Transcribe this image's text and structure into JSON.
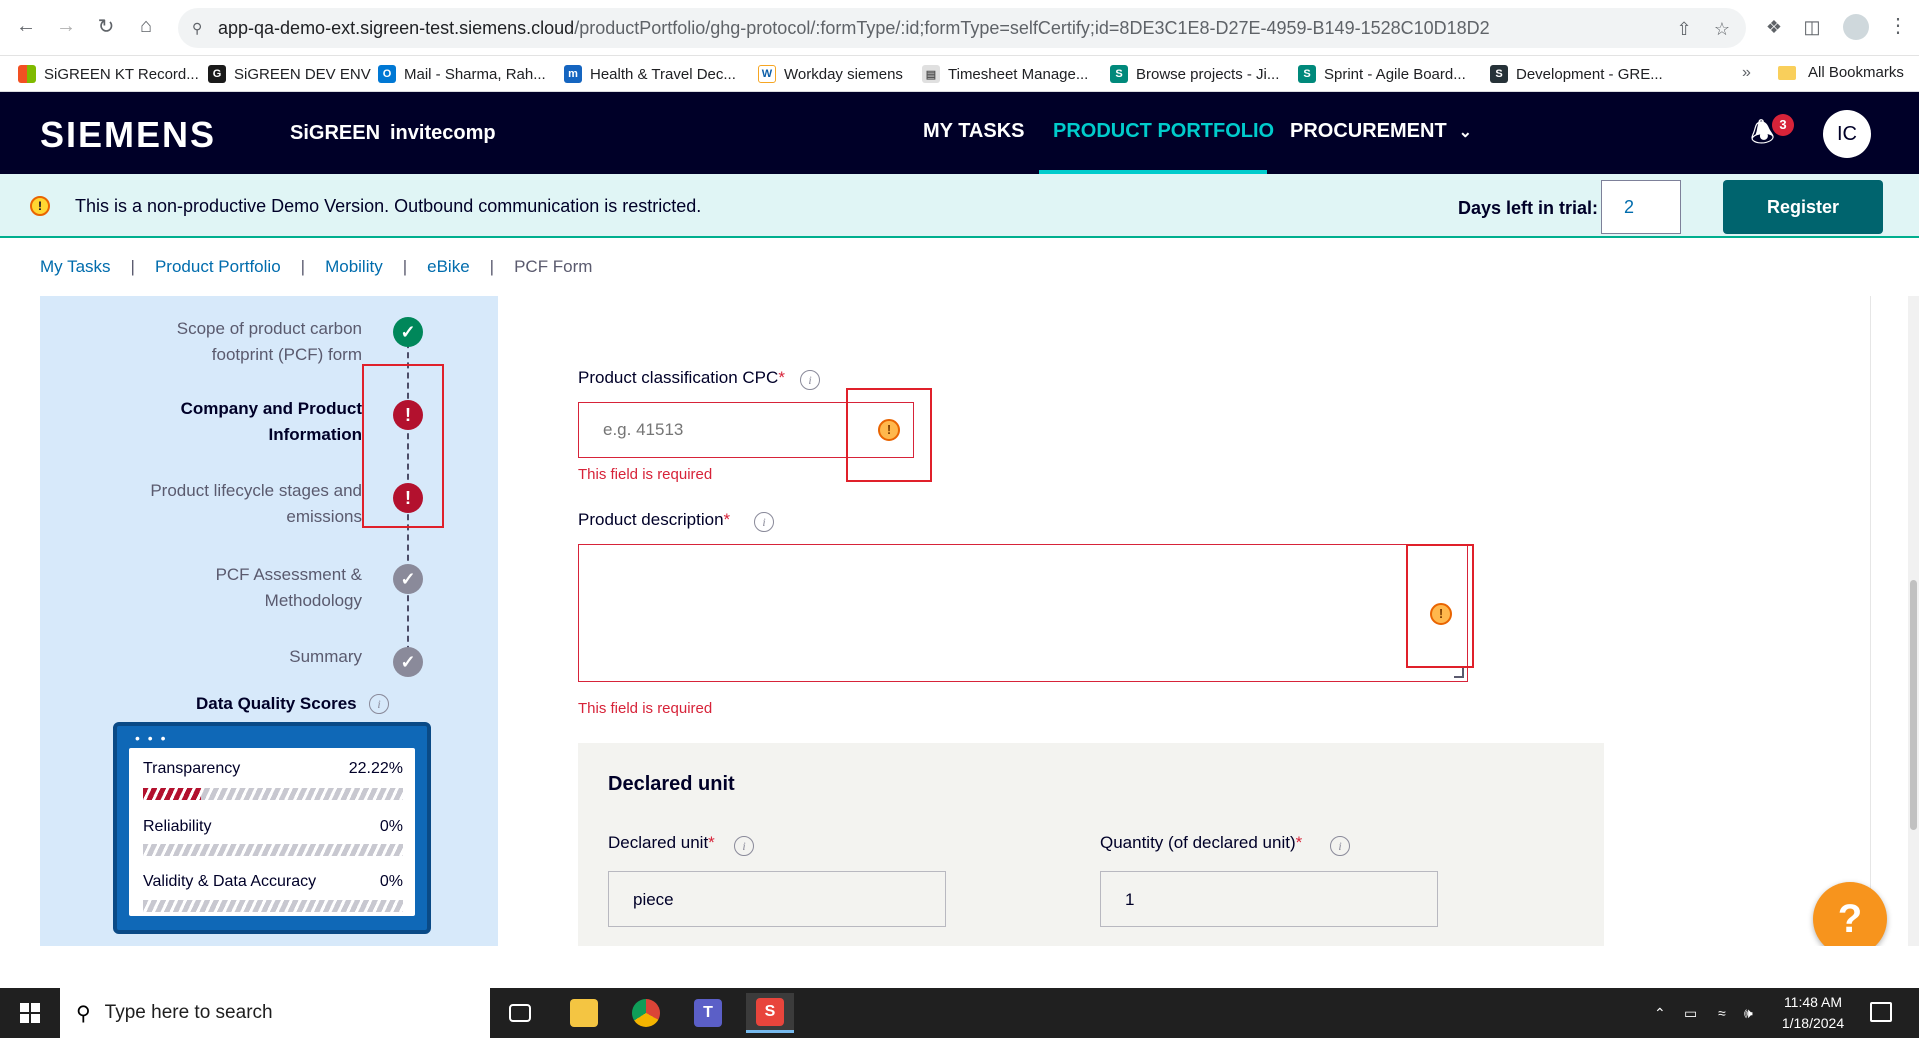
{
  "browser": {
    "url_host": "app-qa-demo-ext.sigreen-test.siemens.cloud",
    "url_path": "/productPortfolio/ghg-protocol/:formType/:id;formType=selfCertify;id=8DE3C1E8-D27E-4959-B149-1528C10D18D2",
    "bookmarks": [
      {
        "label": "SiGREEN KT Record...",
        "icon": "ms-grid-icon",
        "color": "#f25022"
      },
      {
        "label": "SiGREEN DEV ENV",
        "icon": "gw-icon",
        "color": "#1a1a1a"
      },
      {
        "label": "Mail - Sharma, Rah...",
        "icon": "outlook-icon",
        "color": "#0078d4"
      },
      {
        "label": "Health & Travel Dec...",
        "icon": "mx-icon",
        "color": "#1565c0"
      },
      {
        "label": "Workday siemens",
        "icon": "workday-icon",
        "color": "#f6a623"
      },
      {
        "label": "Timesheet Manage...",
        "icon": "doc-icon",
        "color": "#9e9e9e"
      },
      {
        "label": "Browse projects - Ji...",
        "icon": "s-icon",
        "color": "#00897b"
      },
      {
        "label": "Sprint - Agile Board...",
        "icon": "s-icon",
        "color": "#00897b"
      },
      {
        "label": "Development - GRE...",
        "icon": "s-icon",
        "color": "#263238"
      }
    ],
    "more": "»",
    "all_bookmarks": "All Bookmarks"
  },
  "header": {
    "brand": "SIEMENS",
    "app_name": "SiGREEN",
    "company": "invitecomp",
    "nav": [
      {
        "label": "MY TASKS",
        "active": false
      },
      {
        "label": "PRODUCT PORTFOLIO",
        "active": true
      },
      {
        "label": "PROCUREMENT",
        "active": false
      }
    ],
    "notification_count": "3",
    "user_initials": "IC"
  },
  "banner": {
    "message": "This is a non-productive Demo Version. Outbound communication is restricted.",
    "trial_label": "Days left in trial:",
    "trial_days": "2",
    "register_label": "Register"
  },
  "breadcrumb": [
    "My Tasks",
    "Product Portfolio",
    "Mobility",
    "eBike",
    "PCF Form"
  ],
  "stepper": {
    "steps": [
      {
        "line1": "Scope of product carbon",
        "line2": "footprint (PCF) form",
        "status": "complete"
      },
      {
        "line1": "Company and Product",
        "line2": "Information",
        "status": "error"
      },
      {
        "line1": "Product lifecycle stages and",
        "line2": "emissions",
        "status": "error"
      },
      {
        "line1": "PCF Assessment &",
        "line2": "Methodology",
        "status": "pending"
      },
      {
        "line1": "Summary",
        "line2": "",
        "status": "pending"
      }
    ],
    "status_glyphs": {
      "complete": "✓",
      "error": "!",
      "pending": "✓"
    }
  },
  "data_quality": {
    "title": "Data Quality Scores",
    "dots": "• • •",
    "scores": [
      {
        "label": "Transparency",
        "value": "22.22%",
        "fraction": 0.2222
      },
      {
        "label": "Reliability",
        "value": "0%",
        "fraction": 0
      },
      {
        "label": "Validity & Data Accuracy",
        "value": "0%",
        "fraction": 0
      }
    ]
  },
  "form": {
    "cpc": {
      "label": "Product classification CPC",
      "required_mark": "*",
      "placeholder": "e.g. 41513",
      "error": "This field is required"
    },
    "description": {
      "label": "Product description",
      "required_mark": "*",
      "value": "",
      "error": "This field is required"
    },
    "declared_unit_section": {
      "title": "Declared unit",
      "unit_label": "Declared unit",
      "unit_value": "piece",
      "quantity_label": "Quantity (of declared unit)",
      "quantity_value": "1",
      "required_mark": "*"
    }
  },
  "help_label": "?",
  "taskbar": {
    "search_placeholder": "Type here to search",
    "time": "11:48 AM",
    "date": "1/18/2024"
  }
}
